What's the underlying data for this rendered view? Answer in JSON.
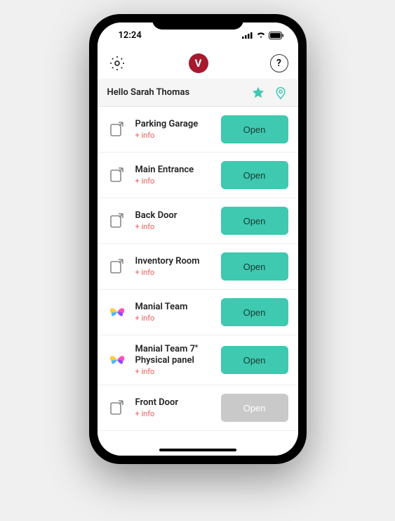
{
  "status": {
    "time": "12:24"
  },
  "header": {
    "logo_letter": "V",
    "help_label": "?"
  },
  "greeting": {
    "text": "Hello Sarah Thomas"
  },
  "colors": {
    "accent": "#3ec9b0",
    "brand": "#a6192e",
    "info_link": "#f05a5a"
  },
  "list": {
    "info_label": "+ info",
    "open_label": "Open",
    "items": [
      {
        "title": "Parking Garage",
        "icon": "door",
        "enabled": true
      },
      {
        "title": "Main Entrance",
        "icon": "door",
        "enabled": true
      },
      {
        "title": "Back Door",
        "icon": "door",
        "enabled": true
      },
      {
        "title": "Inventory Room",
        "icon": "door",
        "enabled": true
      },
      {
        "title": "Manial Team",
        "icon": "butterfly",
        "enabled": true
      },
      {
        "title": "Manial Team 7'' Physical panel",
        "icon": "butterfly",
        "enabled": true
      },
      {
        "title": "Front Door",
        "icon": "door",
        "enabled": false
      }
    ]
  }
}
